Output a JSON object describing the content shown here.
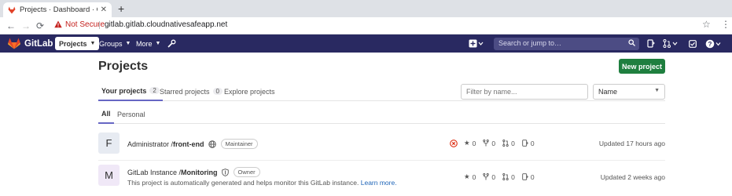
{
  "browser": {
    "tab_title": "Projects · Dashboard · GitLab",
    "tab_close": "✕",
    "new_tab": "+",
    "not_secure": "Not Secure",
    "url": "gitlab.gitlab.cloudnativesafeapp.net",
    "back": "←",
    "forward": "→",
    "reload": "⟳"
  },
  "header": {
    "logo_text": "GitLab",
    "nav": [
      {
        "label": "Projects"
      },
      {
        "label": "Groups"
      },
      {
        "label": "More"
      }
    ],
    "search_placeholder": "Search or jump to…"
  },
  "page": {
    "title": "Projects",
    "new_project_label": "New project",
    "tabs": [
      {
        "label": "Your projects",
        "count": "2"
      },
      {
        "label": "Starred projects",
        "count": "0"
      },
      {
        "label": "Explore projects"
      }
    ],
    "filter_placeholder": "Filter by name...",
    "sort_value": "Name",
    "subtabs": [
      {
        "label": "All"
      },
      {
        "label": "Personal"
      }
    ]
  },
  "projects": [
    {
      "avatar": "F",
      "namespace": "Administrator / ",
      "name": "front-end",
      "role": "Maintainer",
      "stars": "0",
      "forks": "0",
      "merge_requests": "0",
      "issues": "0",
      "updated": "Updated 17 hours ago"
    },
    {
      "avatar": "M",
      "namespace": "GitLab Instance / ",
      "name": "Monitoring",
      "role": "Owner",
      "description": "This project is automatically generated and helps monitor this GitLab instance.",
      "learn_more": "Learn more.",
      "stars": "0",
      "forks": "0",
      "merge_requests": "0",
      "issues": "0",
      "updated": "Updated 2 weeks ago"
    }
  ],
  "colors": {
    "header_bg": "#292961",
    "new_project_bg": "#1f7f3f",
    "active_tab_border": "#6666c4",
    "not_secure": "#c5221f",
    "pipeline_failed": "#dd2b0e"
  },
  "icons": {
    "pipeline_status": "pipeline-failed-icon",
    "public_visibility": "globe-icon",
    "internal_visibility": "shield-icon"
  }
}
